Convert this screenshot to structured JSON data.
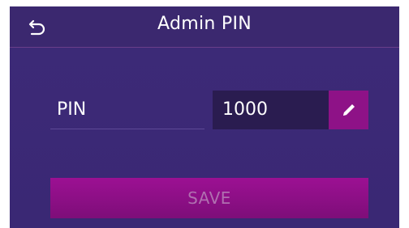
{
  "header": {
    "title": "Admin PIN",
    "back_icon": "back-arrow-icon"
  },
  "form": {
    "pin_label": "PIN",
    "pin_value": "1000",
    "edit_icon": "pencil-icon"
  },
  "actions": {
    "save_label": "SAVE"
  },
  "colors": {
    "background": "#3d2a78",
    "field_background": "#2a1c50",
    "accent": "#8e1287"
  }
}
